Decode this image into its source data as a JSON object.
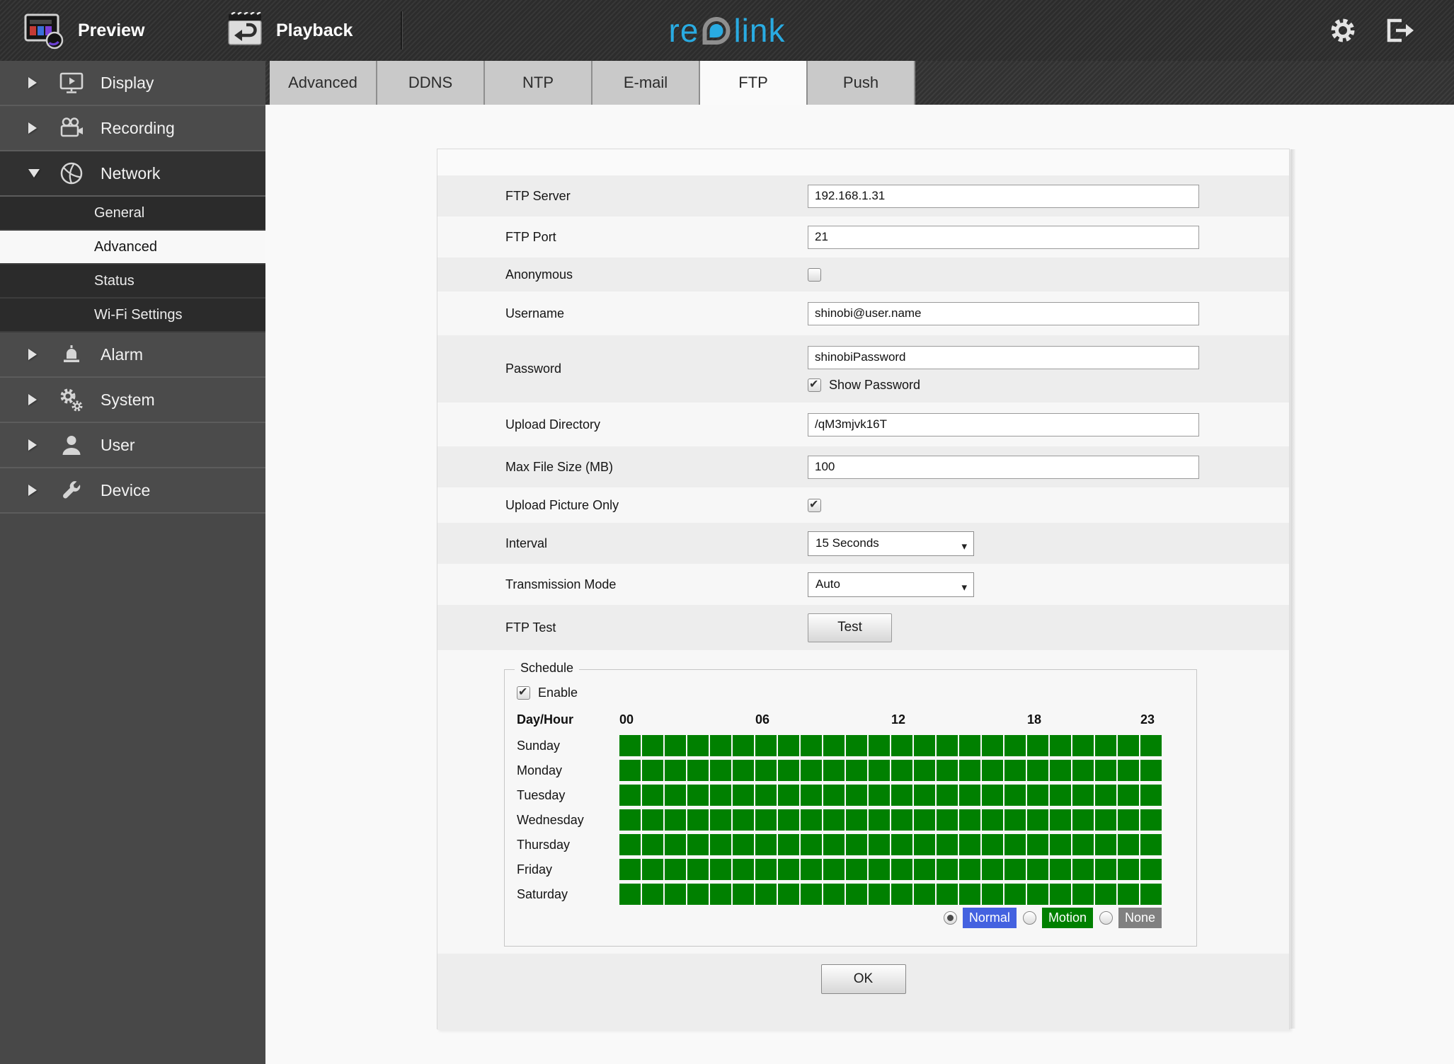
{
  "topbar": {
    "preview_label": "Preview",
    "playback_label": "Playback",
    "logo_part1": "re",
    "logo_part2": "link",
    "logo_color": "#29abe2"
  },
  "sidebar": {
    "items": [
      {
        "label": "Display"
      },
      {
        "label": "Recording"
      },
      {
        "label": "Network",
        "expanded": true
      },
      {
        "label": "Alarm"
      },
      {
        "label": "System"
      },
      {
        "label": "User"
      },
      {
        "label": "Device"
      }
    ],
    "network_children": [
      {
        "label": "General",
        "selected": false
      },
      {
        "label": "Advanced",
        "selected": true
      },
      {
        "label": "Status",
        "selected": false
      },
      {
        "label": "Wi-Fi Settings",
        "selected": false
      }
    ]
  },
  "tabs": {
    "items": [
      {
        "label": "Advanced",
        "active": false
      },
      {
        "label": "DDNS",
        "active": false
      },
      {
        "label": "NTP",
        "active": false
      },
      {
        "label": "E-mail",
        "active": false
      },
      {
        "label": "FTP",
        "active": true
      },
      {
        "label": "Push",
        "active": false
      }
    ]
  },
  "form": {
    "rows": {
      "ftp_server": {
        "label": "FTP Server",
        "value": "192.168.1.31"
      },
      "ftp_port": {
        "label": "FTP Port",
        "value": "21"
      },
      "anonymous": {
        "label": "Anonymous",
        "checked": false
      },
      "username": {
        "label": "Username",
        "value": "shinobi@user.name"
      },
      "password": {
        "label": "Password",
        "value": "shinobiPassword",
        "show_password_label": "Show Password",
        "show_password_checked": true
      },
      "upload_directory": {
        "label": "Upload Directory",
        "value": "/qM3mjvk16T"
      },
      "max_file_size": {
        "label": "Max File Size (MB)",
        "value": "100"
      },
      "upload_picture_only": {
        "label": "Upload Picture Only",
        "checked": true
      },
      "interval": {
        "label": "Interval",
        "value": "15 Seconds"
      },
      "transmission_mode": {
        "label": "Transmission Mode",
        "value": "Auto"
      },
      "ftp_test": {
        "label": "FTP Test",
        "button_label": "Test"
      }
    },
    "ok_label": "OK"
  },
  "schedule": {
    "legend": "Schedule",
    "enable_label": "Enable",
    "enable_checked": true,
    "day_hour_label": "Day/Hour",
    "hours": [
      {
        "label": "00",
        "col": 0
      },
      {
        "label": "06",
        "col": 6
      },
      {
        "label": "12",
        "col": 12
      },
      {
        "label": "18",
        "col": 18
      },
      {
        "label": "23",
        "col": 23
      }
    ],
    "columns": 24,
    "rows": [
      {
        "day": "Sunday",
        "cells": "MMMMMMMMMMMMMMMMMMMMMMMM"
      },
      {
        "day": "Monday",
        "cells": "MMMMMMMMMMMMMMMMMMMMMMMM"
      },
      {
        "day": "Tuesday",
        "cells": "MMMMMMMMMMMMMMMMMMMMMMMM"
      },
      {
        "day": "Wednesday",
        "cells": "MMMMMMMMMMMMMMMMMMMMMMMM"
      },
      {
        "day": "Thursday",
        "cells": "MMMMMMMMMMMMMMMMMMMMMMMM"
      },
      {
        "day": "Friday",
        "cells": "MMMMMMMMMMMMMMMMMMMMMMMM"
      },
      {
        "day": "Saturday",
        "cells": "MMMMMMMMMMMMMMMMMMMMMMMM"
      }
    ],
    "cell_colors": {
      "normal": "#4462e0",
      "motion": "#008000",
      "none": "#808080",
      "empty": "#ffffff"
    },
    "modes": [
      {
        "label": "Normal",
        "color": "#4462e0",
        "selected": true
      },
      {
        "label": "Motion",
        "color": "#008000",
        "selected": false
      },
      {
        "label": "None",
        "color": "#808080",
        "selected": false
      }
    ]
  }
}
